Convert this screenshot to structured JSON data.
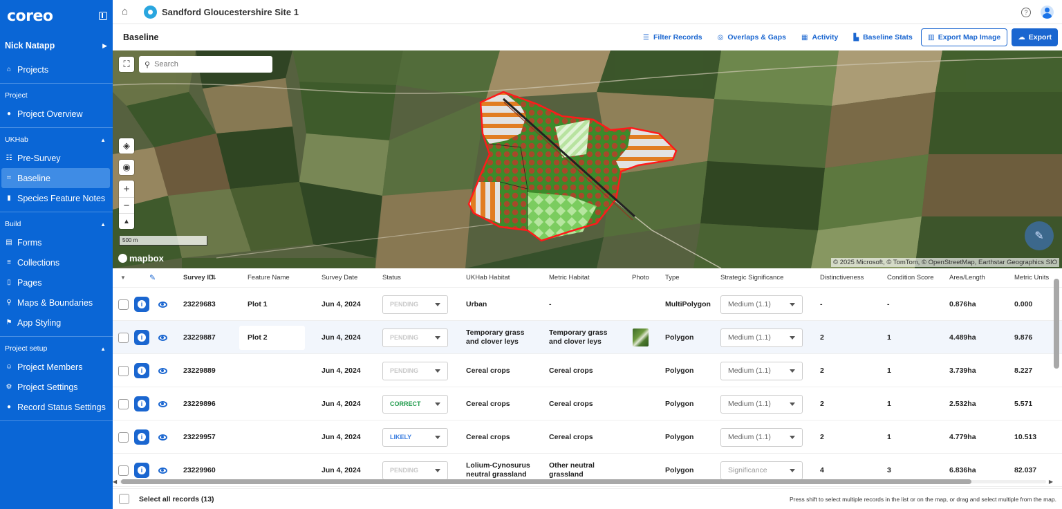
{
  "app": {
    "logo": "coreo",
    "site_title": "Sandford Gloucestershire Site 1"
  },
  "sidebar": {
    "user": "Nick Natapp",
    "projects_label": "Projects",
    "sections": [
      {
        "title": "Project",
        "items": [
          "Project Overview"
        ]
      },
      {
        "title": "UKHab",
        "items": [
          "Pre-Survey",
          "Baseline",
          "Species Feature Notes"
        ]
      },
      {
        "title": "Build",
        "items": [
          "Forms",
          "Collections",
          "Pages",
          "Maps & Boundaries",
          "App Styling"
        ]
      },
      {
        "title": "Project setup",
        "items": [
          "Project Members",
          "Project Settings",
          "Record Status Settings"
        ]
      }
    ],
    "active_item": "Baseline"
  },
  "toolbar": {
    "title": "Baseline",
    "filter": "Filter Records",
    "overlaps": "Overlaps & Gaps",
    "activity": "Activity",
    "stats": "Baseline Stats",
    "export_map": "Export Map Image",
    "export": "Export"
  },
  "map": {
    "search_placeholder": "Search",
    "scale": "500 m",
    "brand": "mapbox",
    "attribution": "© 2025 Microsoft, © TomTom, © OpenStreetMap, Earthstar Geographics SIO"
  },
  "table": {
    "columns": [
      "Survey ID",
      "Feature Name",
      "Survey Date",
      "Status",
      "UKHab Habitat",
      "Metric Habitat",
      "Photo",
      "Type",
      "Strategic Significance",
      "Distinctiveness",
      "Condition Score",
      "Area/Length",
      "Metric Units"
    ],
    "rows": [
      {
        "id": "23229683",
        "name": "Plot 1",
        "date": "Jun 4, 2024",
        "status": "PENDING",
        "ukhab": "Urban",
        "metric": "-",
        "photo": false,
        "type": "MultiPolygon",
        "significance": "Medium (1.1)",
        "distinct": "-",
        "condition": "-",
        "area": "0.876ha",
        "units": "0.000"
      },
      {
        "id": "23229887",
        "name": "Plot 2",
        "date": "Jun 4, 2024",
        "status": "PENDING",
        "ukhab": "Temporary grass and clover leys",
        "metric": "Temporary grass and clover leys",
        "photo": true,
        "type": "Polygon",
        "significance": "Medium (1.1)",
        "distinct": "2",
        "condition": "1",
        "area": "4.489ha",
        "units": "9.876"
      },
      {
        "id": "23229889",
        "name": "",
        "date": "Jun 4, 2024",
        "status": "PENDING",
        "ukhab": "Cereal crops",
        "metric": "Cereal crops",
        "photo": false,
        "type": "Polygon",
        "significance": "Medium (1.1)",
        "distinct": "2",
        "condition": "1",
        "area": "3.739ha",
        "units": "8.227"
      },
      {
        "id": "23229896",
        "name": "",
        "date": "Jun 4, 2024",
        "status": "CORRECT",
        "ukhab": "Cereal crops",
        "metric": "Cereal crops",
        "photo": false,
        "type": "Polygon",
        "significance": "Medium (1.1)",
        "distinct": "2",
        "condition": "1",
        "area": "2.532ha",
        "units": "5.571"
      },
      {
        "id": "23229957",
        "name": "",
        "date": "Jun 4, 2024",
        "status": "LIKELY",
        "ukhab": "Cereal crops",
        "metric": "Cereal crops",
        "photo": false,
        "type": "Polygon",
        "significance": "Medium (1.1)",
        "distinct": "2",
        "condition": "1",
        "area": "4.779ha",
        "units": "10.513"
      },
      {
        "id": "23229960",
        "name": "",
        "date": "Jun 4, 2024",
        "status": "PENDING",
        "ukhab": "Lolium-Cynosurus neutral grassland",
        "metric": "Other neutral grassland",
        "photo": false,
        "type": "Polygon",
        "significance": "Significance",
        "distinct": "4",
        "condition": "3",
        "area": "6.836ha",
        "units": "82.037"
      }
    ],
    "status_colors": {
      "PENDING": "#c8c8c8",
      "CORRECT": "#1e9a4a",
      "LIKELY": "#3a7de0"
    }
  },
  "footer": {
    "select_all": "Select all records (13)",
    "hint": "Press shift to select multiple records in the list or on the map, or drag and select multiple from the map."
  }
}
